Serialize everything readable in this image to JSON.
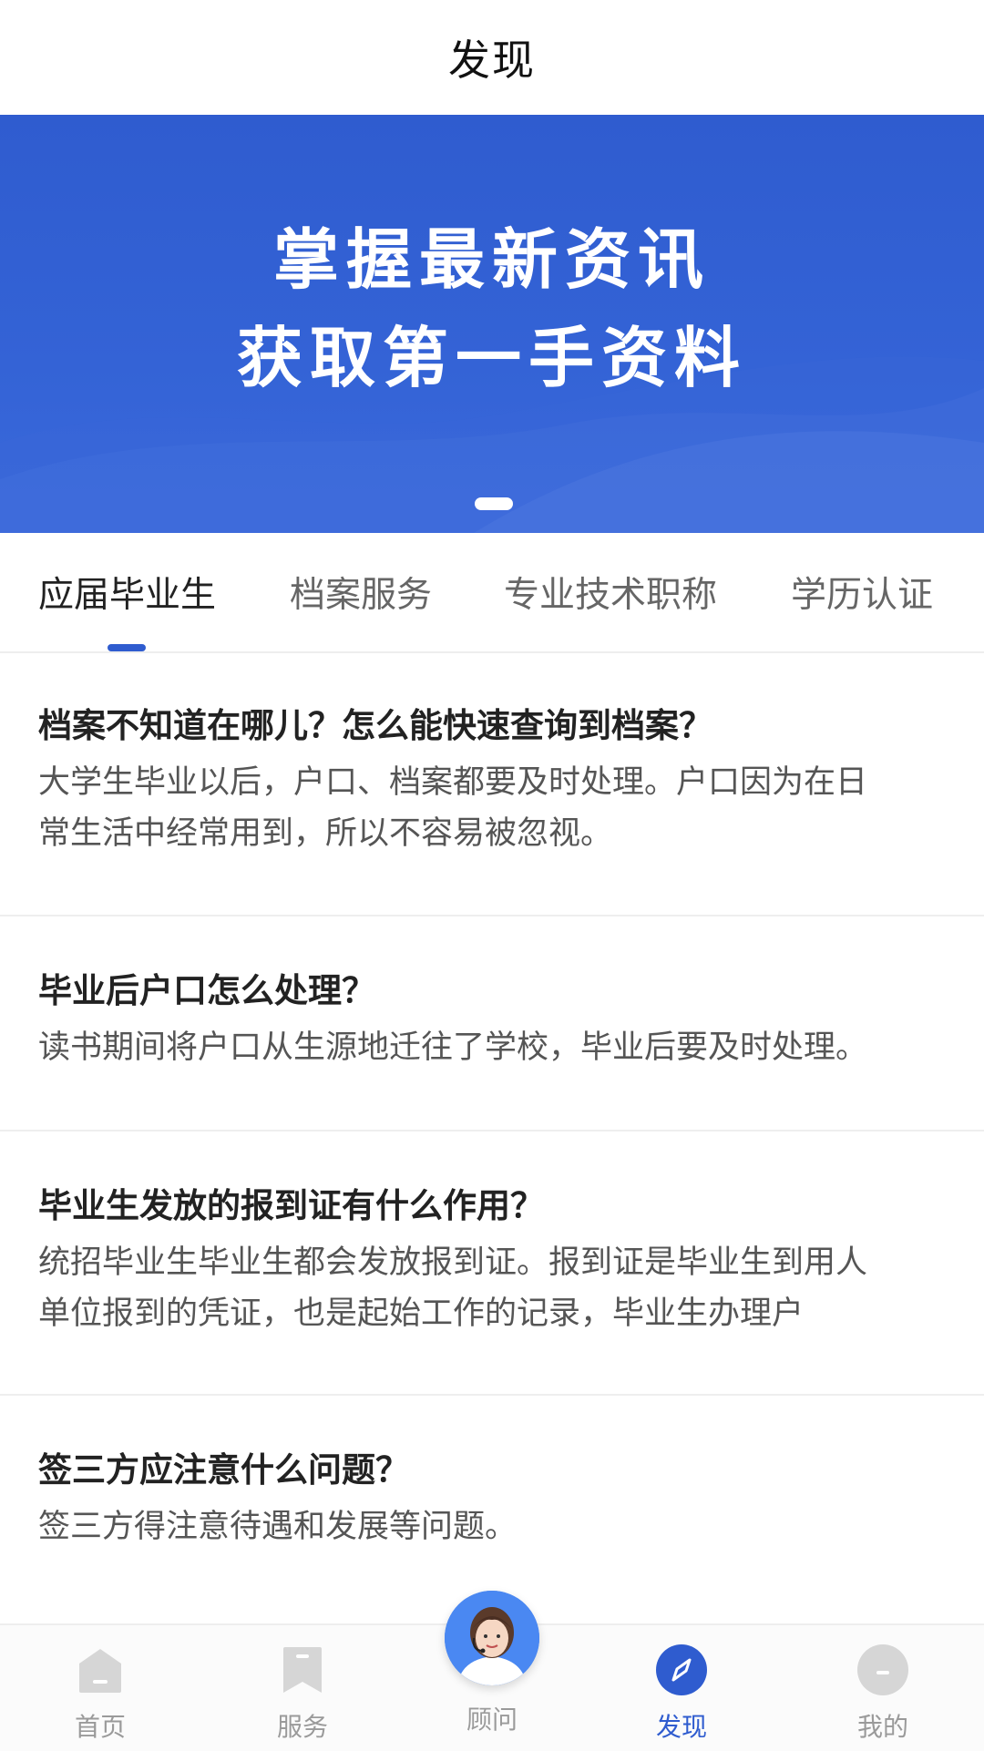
{
  "header": {
    "title": "发现"
  },
  "banner": {
    "line1": "掌握最新资讯",
    "line2": "获取第一手资料"
  },
  "tabs": [
    {
      "label": "应届毕业生",
      "active": true
    },
    {
      "label": "档案服务",
      "active": false
    },
    {
      "label": "专业技术职称",
      "active": false
    },
    {
      "label": "学历认证",
      "active": false
    }
  ],
  "articles": [
    {
      "title": "档案不知道在哪儿？怎么能快速查询到档案？",
      "desc": "大学生毕业以后，户口、档案都要及时处理。户口因为在日常生活中经常用到，所以不容易被忽视。"
    },
    {
      "title": "毕业后户口怎么处理？",
      "desc": "读书期间将户口从生源地迁往了学校，毕业后要及时处理。"
    },
    {
      "title": "毕业生发放的报到证有什么作用？",
      "desc": "统招毕业生毕业生都会发放报到证。报到证是毕业生到用人单位报到的凭证，也是起始工作的记录，毕业生办理户"
    },
    {
      "title": "签三方应注意什么问题？",
      "desc": "签三方得注意待遇和发展等问题。"
    }
  ],
  "bottom_nav": {
    "items": [
      {
        "label": "首页",
        "icon": "home-icon",
        "active": false
      },
      {
        "label": "服务",
        "icon": "bookmark-icon",
        "active": false
      },
      {
        "label": "顾问",
        "icon": "advisor-avatar",
        "active": false
      },
      {
        "label": "发现",
        "icon": "compass-icon",
        "active": true
      },
      {
        "label": "我的",
        "icon": "profile-icon",
        "active": false
      }
    ]
  },
  "colors": {
    "accent": "#2f5ccf",
    "inactive": "#9a9a9a"
  }
}
